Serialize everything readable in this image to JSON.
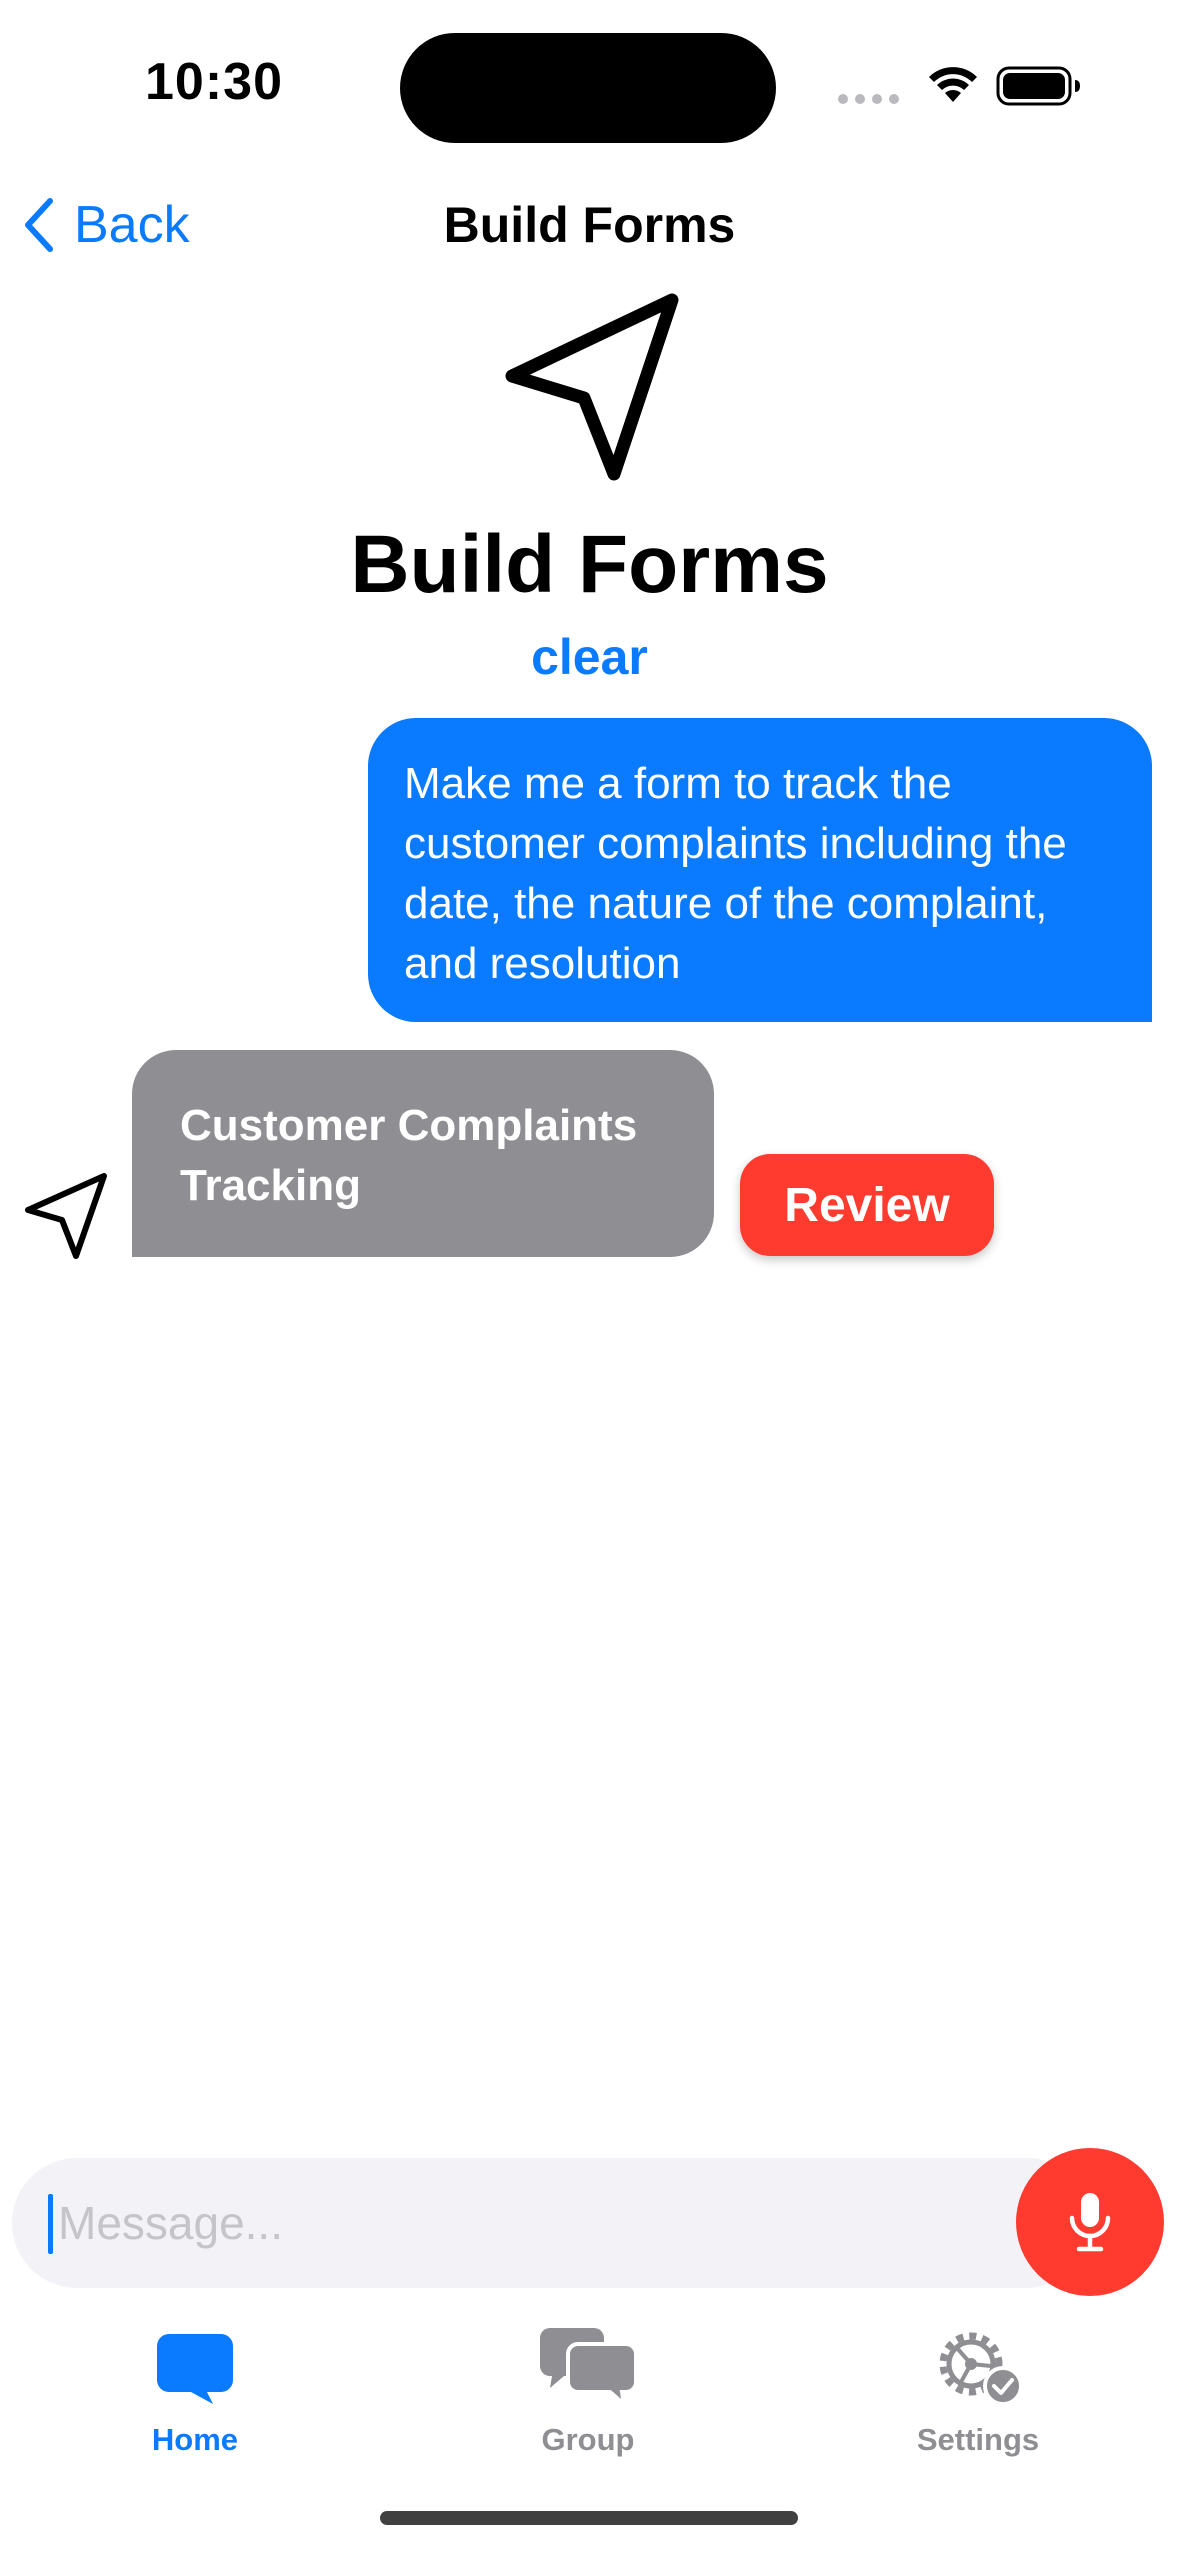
{
  "status_bar": {
    "time": "10:30"
  },
  "nav": {
    "back_label": "Back",
    "title": "Build Forms"
  },
  "header": {
    "icon": "paper-plane-icon",
    "title": "Build Forms",
    "clear_label": "clear"
  },
  "chat": {
    "messages": [
      {
        "role": "user",
        "text": "Make me a form to track the customer complaints including the date, the nature of the complaint, and resolution"
      },
      {
        "role": "bot",
        "avatar_icon": "paper-plane-icon",
        "text": "Customer Complaints Tracking",
        "action_label": "Review"
      }
    ]
  },
  "composer": {
    "placeholder": "Message...",
    "value": "",
    "mic_icon": "microphone-icon"
  },
  "tab_bar": {
    "tabs": [
      {
        "label": "Home",
        "icon": "chat-bubble-icon",
        "active": true
      },
      {
        "label": "Group",
        "icon": "group-chat-icon",
        "active": false
      },
      {
        "label": "Settings",
        "icon": "settings-gear-icon",
        "active": false
      }
    ]
  },
  "colors": {
    "accent": "#0a7aff",
    "user_bubble": "#0a7aff",
    "bot_bubble": "#8e8e93",
    "destructive": "#ff3b30",
    "input_bg": "#f2f2f7",
    "inactive_tab": "#8e8e93"
  }
}
